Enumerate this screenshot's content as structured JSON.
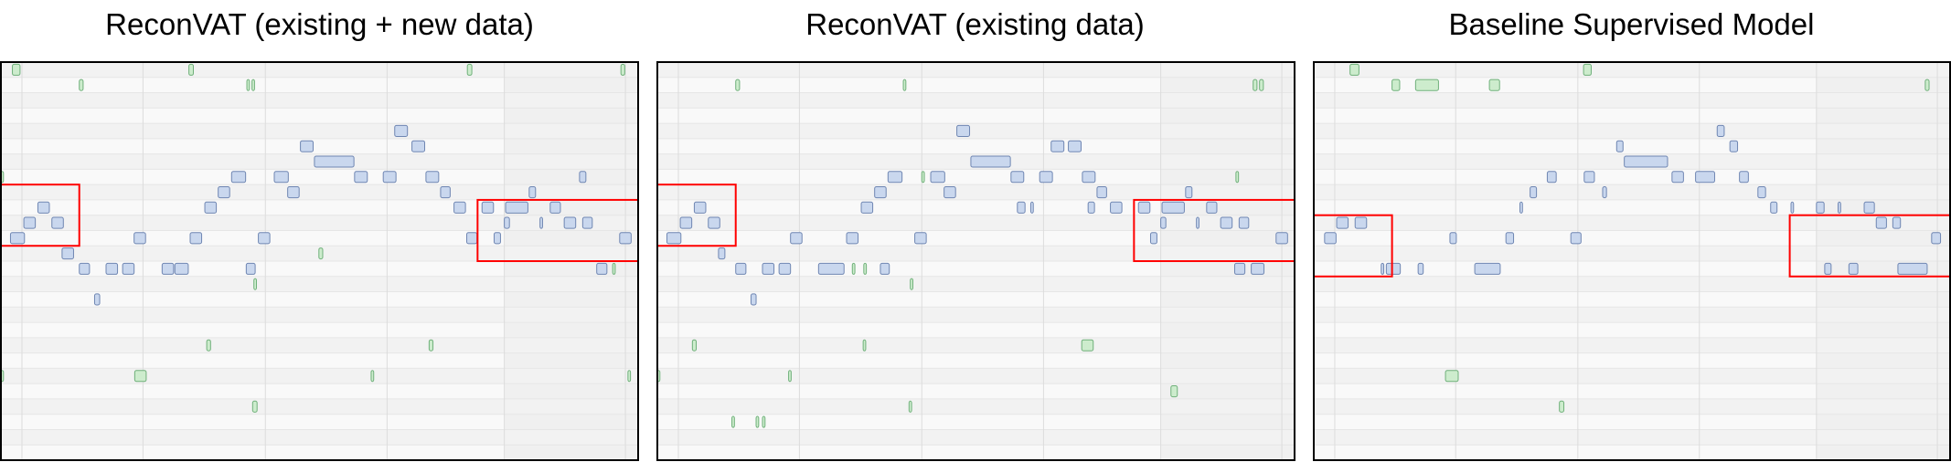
{
  "chart_data": [
    {
      "type": "piano-roll",
      "title": "ReconVAT (existing + new data)",
      "colors": {
        "note_blue_fill": "#c9d7ee",
        "note_blue_stroke": "#6f86b2",
        "note_green_fill": "#cdeccd",
        "note_green_stroke": "#6fb07a",
        "highlight_box": "#ff0000",
        "frame": "#000000"
      },
      "pitch_range": [
        0,
        26
      ],
      "time_range": [
        0,
        100
      ],
      "notes": [
        {
          "t": 1.8,
          "d": 1.2,
          "p": 0,
          "c": "g"
        },
        {
          "t": 12.3,
          "d": 0.6,
          "p": 1,
          "c": "g"
        },
        {
          "t": 29.5,
          "d": 0.7,
          "p": 0,
          "c": "g"
        },
        {
          "t": 38.6,
          "d": 0.4,
          "p": 1,
          "c": "g"
        },
        {
          "t": 39.4,
          "d": 0.4,
          "p": 1,
          "c": "g"
        },
        {
          "t": 73.2,
          "d": 0.7,
          "p": 0,
          "c": "g"
        },
        {
          "t": 97.3,
          "d": 0.6,
          "p": 0,
          "c": "g"
        },
        {
          "t": 61.8,
          "d": 2,
          "p": 4,
          "c": "b"
        },
        {
          "t": 47,
          "d": 2,
          "p": 5,
          "c": "b"
        },
        {
          "t": 64.5,
          "d": 2,
          "p": 5,
          "c": "b"
        },
        {
          "t": 49.2,
          "d": 6.2,
          "p": 6,
          "c": "b"
        },
        {
          "t": 36.2,
          "d": 2.2,
          "p": 7,
          "c": "b"
        },
        {
          "t": 42.9,
          "d": 2.2,
          "p": 7,
          "c": "b"
        },
        {
          "t": 55.5,
          "d": 2,
          "p": 7,
          "c": "b"
        },
        {
          "t": 60,
          "d": 2,
          "p": 7,
          "c": "b"
        },
        {
          "t": 66.7,
          "d": 2,
          "p": 7,
          "c": "b"
        },
        {
          "t": 90.8,
          "d": 1,
          "p": 7,
          "c": "b"
        },
        {
          "t": 0,
          "d": 0.4,
          "p": 7,
          "c": "g"
        },
        {
          "t": 34.1,
          "d": 1.8,
          "p": 8,
          "c": "b"
        },
        {
          "t": 45,
          "d": 1.8,
          "p": 8,
          "c": "b"
        },
        {
          "t": 69,
          "d": 1.5,
          "p": 8,
          "c": "b"
        },
        {
          "t": 82.9,
          "d": 1,
          "p": 8,
          "c": "b"
        },
        {
          "t": 32,
          "d": 1.8,
          "p": 9,
          "c": "b"
        },
        {
          "t": 71.1,
          "d": 1.8,
          "p": 9,
          "c": "b"
        },
        {
          "t": 75.5,
          "d": 1.8,
          "p": 9,
          "c": "b"
        },
        {
          "t": 79.2,
          "d": 3.5,
          "p": 9,
          "c": "b"
        },
        {
          "t": 86.2,
          "d": 1.6,
          "p": 9,
          "c": "b"
        },
        {
          "t": 5.8,
          "d": 1.8,
          "p": 9,
          "c": "b"
        },
        {
          "t": 3.6,
          "d": 1.8,
          "p": 10,
          "c": "b"
        },
        {
          "t": 8,
          "d": 1.8,
          "p": 10,
          "c": "b"
        },
        {
          "t": 79,
          "d": 0.8,
          "p": 10,
          "c": "b"
        },
        {
          "t": 84.6,
          "d": 0.4,
          "p": 10,
          "c": "b"
        },
        {
          "t": 88.4,
          "d": 1.8,
          "p": 10,
          "c": "b"
        },
        {
          "t": 91.3,
          "d": 1.5,
          "p": 10,
          "c": "b"
        },
        {
          "t": 1.5,
          "d": 2.2,
          "p": 11,
          "c": "b"
        },
        {
          "t": 20.9,
          "d": 1.8,
          "p": 11,
          "c": "b"
        },
        {
          "t": 29.7,
          "d": 1.8,
          "p": 11,
          "c": "b"
        },
        {
          "t": 40.4,
          "d": 1.8,
          "p": 11,
          "c": "b"
        },
        {
          "t": 73.1,
          "d": 1.6,
          "p": 11,
          "c": "b"
        },
        {
          "t": 77.4,
          "d": 1,
          "p": 11,
          "c": "b"
        },
        {
          "t": 97.1,
          "d": 1.8,
          "p": 11,
          "c": "b"
        },
        {
          "t": 9.6,
          "d": 1.8,
          "p": 12,
          "c": "b"
        },
        {
          "t": 49.9,
          "d": 0.6,
          "p": 12,
          "c": "g"
        },
        {
          "t": 12.3,
          "d": 1.6,
          "p": 13,
          "c": "b"
        },
        {
          "t": 16.5,
          "d": 1.8,
          "p": 13,
          "c": "b"
        },
        {
          "t": 19.1,
          "d": 1.8,
          "p": 13,
          "c": "b"
        },
        {
          "t": 25.3,
          "d": 1.8,
          "p": 13,
          "c": "b"
        },
        {
          "t": 27.3,
          "d": 2.1,
          "p": 13,
          "c": "b"
        },
        {
          "t": 38.5,
          "d": 1.4,
          "p": 13,
          "c": "b"
        },
        {
          "t": 93.5,
          "d": 1.6,
          "p": 13,
          "c": "b"
        },
        {
          "t": 96,
          "d": 0.4,
          "p": 13,
          "c": "g"
        },
        {
          "t": 39.7,
          "d": 0.4,
          "p": 14,
          "c": "g"
        },
        {
          "t": 14.7,
          "d": 0.8,
          "p": 15,
          "c": "b"
        },
        {
          "t": 32.3,
          "d": 0.6,
          "p": 18,
          "c": "g"
        },
        {
          "t": 67.2,
          "d": 0.6,
          "p": 18,
          "c": "g"
        },
        {
          "t": 0,
          "d": 0.4,
          "p": 20,
          "c": "g"
        },
        {
          "t": 21,
          "d": 1.8,
          "p": 20,
          "c": "g"
        },
        {
          "t": 58.1,
          "d": 0.4,
          "p": 20,
          "c": "g"
        },
        {
          "t": 98.4,
          "d": 0.4,
          "p": 20,
          "c": "g"
        },
        {
          "t": 39.5,
          "d": 0.7,
          "p": 22,
          "c": "g"
        }
      ],
      "highlight_boxes": [
        {
          "t0": 0,
          "t1": 12.3,
          "p0": 8,
          "p1": 12
        },
        {
          "t0": 74.8,
          "t1": 100,
          "p0": 9,
          "p1": 13
        }
      ]
    },
    {
      "type": "piano-roll",
      "title": "ReconVAT (existing data)",
      "pitch_range": [
        0,
        26
      ],
      "time_range": [
        0,
        100
      ],
      "notes": [
        {
          "t": 12.3,
          "d": 0.6,
          "p": 1,
          "c": "g"
        },
        {
          "t": 38.6,
          "d": 0.4,
          "p": 1,
          "c": "g"
        },
        {
          "t": 93.5,
          "d": 0.6,
          "p": 1,
          "c": "g"
        },
        {
          "t": 94.5,
          "d": 0.6,
          "p": 1,
          "c": "g"
        },
        {
          "t": 47,
          "d": 2,
          "p": 4,
          "c": "b"
        },
        {
          "t": 64.5,
          "d": 2,
          "p": 5,
          "c": "b"
        },
        {
          "t": 61.8,
          "d": 2,
          "p": 5,
          "c": "b"
        },
        {
          "t": 49.2,
          "d": 6.2,
          "p": 6,
          "c": "b"
        },
        {
          "t": 36.2,
          "d": 2.2,
          "p": 7,
          "c": "b"
        },
        {
          "t": 41.5,
          "d": 0.4,
          "p": 7,
          "c": "g"
        },
        {
          "t": 42.9,
          "d": 2.2,
          "p": 7,
          "c": "b"
        },
        {
          "t": 55.5,
          "d": 2,
          "p": 7,
          "c": "b"
        },
        {
          "t": 60,
          "d": 2,
          "p": 7,
          "c": "b"
        },
        {
          "t": 66.7,
          "d": 2,
          "p": 7,
          "c": "b"
        },
        {
          "t": 90.8,
          "d": 0.4,
          "p": 7,
          "c": "g"
        },
        {
          "t": 34.1,
          "d": 1.8,
          "p": 8,
          "c": "b"
        },
        {
          "t": 45,
          "d": 1.8,
          "p": 8,
          "c": "b"
        },
        {
          "t": 69,
          "d": 1.5,
          "p": 8,
          "c": "b"
        },
        {
          "t": 82.9,
          "d": 1,
          "p": 8,
          "c": "b"
        },
        {
          "t": 32,
          "d": 1.8,
          "p": 9,
          "c": "b"
        },
        {
          "t": 56.5,
          "d": 1.2,
          "p": 9,
          "c": "b"
        },
        {
          "t": 58.6,
          "d": 0.4,
          "p": 9,
          "c": "b"
        },
        {
          "t": 67.6,
          "d": 1,
          "p": 9,
          "c": "b"
        },
        {
          "t": 71.1,
          "d": 1.8,
          "p": 9,
          "c": "b"
        },
        {
          "t": 75.5,
          "d": 1.8,
          "p": 9,
          "c": "b"
        },
        {
          "t": 79.2,
          "d": 3.5,
          "p": 9,
          "c": "b"
        },
        {
          "t": 86.2,
          "d": 1.6,
          "p": 9,
          "c": "b"
        },
        {
          "t": 5.8,
          "d": 1.8,
          "p": 9,
          "c": "b"
        },
        {
          "t": 3.6,
          "d": 1.8,
          "p": 10,
          "c": "b"
        },
        {
          "t": 8,
          "d": 1.8,
          "p": 10,
          "c": "b"
        },
        {
          "t": 79,
          "d": 0.8,
          "p": 10,
          "c": "b"
        },
        {
          "t": 84.6,
          "d": 0.4,
          "p": 10,
          "c": "b"
        },
        {
          "t": 88.4,
          "d": 1.8,
          "p": 10,
          "c": "b"
        },
        {
          "t": 91.3,
          "d": 1.5,
          "p": 10,
          "c": "b"
        },
        {
          "t": 1.5,
          "d": 2.2,
          "p": 11,
          "c": "b"
        },
        {
          "t": 20.9,
          "d": 1.8,
          "p": 11,
          "c": "b"
        },
        {
          "t": 29.7,
          "d": 1.8,
          "p": 11,
          "c": "b"
        },
        {
          "t": 40.4,
          "d": 1.8,
          "p": 11,
          "c": "b"
        },
        {
          "t": 77.4,
          "d": 1,
          "p": 11,
          "c": "b"
        },
        {
          "t": 97.1,
          "d": 1.8,
          "p": 11,
          "c": "b"
        },
        {
          "t": 9.6,
          "d": 1,
          "p": 12,
          "c": "b"
        },
        {
          "t": 12.3,
          "d": 1.6,
          "p": 13,
          "c": "b"
        },
        {
          "t": 16.5,
          "d": 1.8,
          "p": 13,
          "c": "b"
        },
        {
          "t": 19.1,
          "d": 1.8,
          "p": 13,
          "c": "b"
        },
        {
          "t": 25.3,
          "d": 4,
          "p": 13,
          "c": "b"
        },
        {
          "t": 30.6,
          "d": 0.4,
          "p": 13,
          "c": "g"
        },
        {
          "t": 32.4,
          "d": 0.4,
          "p": 13,
          "c": "g"
        },
        {
          "t": 35,
          "d": 1.4,
          "p": 13,
          "c": "b"
        },
        {
          "t": 90.6,
          "d": 1.6,
          "p": 13,
          "c": "b"
        },
        {
          "t": 93.2,
          "d": 2,
          "p": 13,
          "c": "b"
        },
        {
          "t": 39.7,
          "d": 0.4,
          "p": 14,
          "c": "g"
        },
        {
          "t": 14.7,
          "d": 0.8,
          "p": 15,
          "c": "b"
        },
        {
          "t": 5.5,
          "d": 0.6,
          "p": 18,
          "c": "g"
        },
        {
          "t": 32.3,
          "d": 0.4,
          "p": 18,
          "c": "g"
        },
        {
          "t": 66.6,
          "d": 1.8,
          "p": 18,
          "c": "g"
        },
        {
          "t": 0,
          "d": 0.4,
          "p": 20,
          "c": "g"
        },
        {
          "t": 20.6,
          "d": 0.4,
          "p": 20,
          "c": "g"
        },
        {
          "t": 80.6,
          "d": 1,
          "p": 21,
          "c": "g"
        },
        {
          "t": 39.5,
          "d": 0.4,
          "p": 22,
          "c": "g"
        },
        {
          "t": 11.7,
          "d": 0.4,
          "p": 23,
          "c": "g"
        },
        {
          "t": 15.5,
          "d": 0.4,
          "p": 23,
          "c": "g"
        },
        {
          "t": 16.5,
          "d": 0.4,
          "p": 23,
          "c": "g"
        }
      ],
      "highlight_boxes": [
        {
          "t0": 0,
          "t1": 12.3,
          "p0": 8,
          "p1": 12
        },
        {
          "t0": 74.8,
          "t1": 100,
          "p0": 9,
          "p1": 13
        }
      ]
    },
    {
      "type": "piano-roll",
      "title": "Baseline Supervised Model",
      "pitch_range": [
        0,
        26
      ],
      "time_range": [
        0,
        100
      ],
      "notes": [
        {
          "t": 5.7,
          "d": 1.4,
          "p": 0,
          "c": "g"
        },
        {
          "t": 42.4,
          "d": 1.2,
          "p": 0,
          "c": "g"
        },
        {
          "t": 12.3,
          "d": 1.2,
          "p": 1,
          "c": "g"
        },
        {
          "t": 16,
          "d": 3.6,
          "p": 1,
          "c": "g"
        },
        {
          "t": 27.6,
          "d": 1.6,
          "p": 1,
          "c": "g"
        },
        {
          "t": 96.1,
          "d": 0.6,
          "p": 1,
          "c": "g"
        },
        {
          "t": 63.4,
          "d": 1.1,
          "p": 4,
          "c": "b"
        },
        {
          "t": 47.6,
          "d": 1,
          "p": 5,
          "c": "b"
        },
        {
          "t": 65.4,
          "d": 1.2,
          "p": 5,
          "c": "b"
        },
        {
          "t": 48.8,
          "d": 6.8,
          "p": 6,
          "c": "b"
        },
        {
          "t": 36.7,
          "d": 1.4,
          "p": 7,
          "c": "b"
        },
        {
          "t": 42.5,
          "d": 1.6,
          "p": 7,
          "c": "b"
        },
        {
          "t": 56.3,
          "d": 1.8,
          "p": 7,
          "c": "b"
        },
        {
          "t": 60,
          "d": 3,
          "p": 7,
          "c": "b"
        },
        {
          "t": 66.9,
          "d": 1.4,
          "p": 7,
          "c": "b"
        },
        {
          "t": 34,
          "d": 1,
          "p": 8,
          "c": "b"
        },
        {
          "t": 45.4,
          "d": 0.6,
          "p": 8,
          "c": "b"
        },
        {
          "t": 69.8,
          "d": 1.2,
          "p": 8,
          "c": "b"
        },
        {
          "t": 32.4,
          "d": 0.4,
          "p": 9,
          "c": "b"
        },
        {
          "t": 71.8,
          "d": 1,
          "p": 9,
          "c": "b"
        },
        {
          "t": 75,
          "d": 0.4,
          "p": 9,
          "c": "b"
        },
        {
          "t": 79,
          "d": 1.2,
          "p": 9,
          "c": "b"
        },
        {
          "t": 82.4,
          "d": 0.4,
          "p": 9,
          "c": "b"
        },
        {
          "t": 86.5,
          "d": 1.6,
          "p": 9,
          "c": "b"
        },
        {
          "t": 3.6,
          "d": 1.8,
          "p": 10,
          "c": "b"
        },
        {
          "t": 6.5,
          "d": 1.8,
          "p": 10,
          "c": "b"
        },
        {
          "t": 88.4,
          "d": 1.6,
          "p": 10,
          "c": "b"
        },
        {
          "t": 91,
          "d": 1.2,
          "p": 10,
          "c": "b"
        },
        {
          "t": 1.7,
          "d": 1.8,
          "p": 11,
          "c": "b"
        },
        {
          "t": 21.4,
          "d": 1,
          "p": 11,
          "c": "b"
        },
        {
          "t": 30.2,
          "d": 1.2,
          "p": 11,
          "c": "b"
        },
        {
          "t": 40.4,
          "d": 1.6,
          "p": 11,
          "c": "b"
        },
        {
          "t": 97.1,
          "d": 1.4,
          "p": 11,
          "c": "b"
        },
        {
          "t": 10.6,
          "d": 0.4,
          "p": 13,
          "c": "b"
        },
        {
          "t": 11.4,
          "d": 2.2,
          "p": 13,
          "c": "b"
        },
        {
          "t": 16.4,
          "d": 0.8,
          "p": 13,
          "c": "b"
        },
        {
          "t": 25.3,
          "d": 4,
          "p": 13,
          "c": "b"
        },
        {
          "t": 80.3,
          "d": 1,
          "p": 13,
          "c": "b"
        },
        {
          "t": 84.1,
          "d": 1.4,
          "p": 13,
          "c": "b"
        },
        {
          "t": 91.8,
          "d": 4.6,
          "p": 13,
          "c": "b"
        },
        {
          "t": 20.7,
          "d": 2,
          "p": 20,
          "c": "g"
        },
        {
          "t": 38.6,
          "d": 0.7,
          "p": 22,
          "c": "g"
        }
      ],
      "highlight_boxes": [
        {
          "t0": 0,
          "t1": 12.3,
          "p0": 10,
          "p1": 14
        },
        {
          "t0": 74.8,
          "t1": 100,
          "p0": 10,
          "p1": 14
        }
      ]
    }
  ]
}
